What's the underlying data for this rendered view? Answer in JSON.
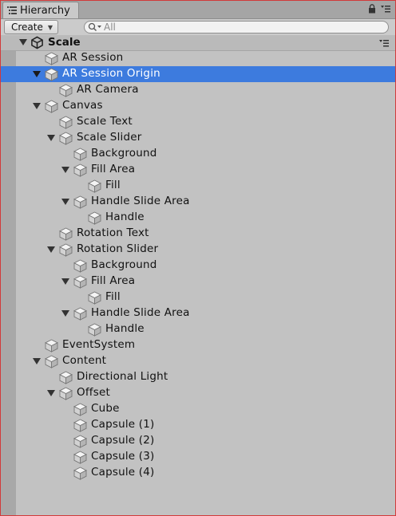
{
  "tab": {
    "label": "Hierarchy",
    "icon": "hierarchy-list-icon"
  },
  "toolbar": {
    "create_label": "Create",
    "search_placeholder": "All"
  },
  "scene": {
    "name": "Scale",
    "icon": "unity-scene-icon",
    "expanded": true
  },
  "tree": [
    {
      "label": "AR Session",
      "depth": 0,
      "expandable": false
    },
    {
      "label": "AR Session Origin",
      "depth": 0,
      "expandable": true,
      "expanded": true,
      "selected": true
    },
    {
      "label": "AR Camera",
      "depth": 1,
      "expandable": false
    },
    {
      "label": "Canvas",
      "depth": 0,
      "expandable": true,
      "expanded": true
    },
    {
      "label": "Scale Text",
      "depth": 1,
      "expandable": false
    },
    {
      "label": "Scale Slider",
      "depth": 1,
      "expandable": true,
      "expanded": true
    },
    {
      "label": "Background",
      "depth": 2,
      "expandable": false
    },
    {
      "label": "Fill Area",
      "depth": 2,
      "expandable": true,
      "expanded": true
    },
    {
      "label": "Fill",
      "depth": 3,
      "expandable": false
    },
    {
      "label": "Handle Slide Area",
      "depth": 2,
      "expandable": true,
      "expanded": true
    },
    {
      "label": "Handle",
      "depth": 3,
      "expandable": false
    },
    {
      "label": "Rotation Text",
      "depth": 1,
      "expandable": false
    },
    {
      "label": "Rotation Slider",
      "depth": 1,
      "expandable": true,
      "expanded": true
    },
    {
      "label": "Background",
      "depth": 2,
      "expandable": false
    },
    {
      "label": "Fill Area",
      "depth": 2,
      "expandable": true,
      "expanded": true
    },
    {
      "label": "Fill",
      "depth": 3,
      "expandable": false
    },
    {
      "label": "Handle Slide Area",
      "depth": 2,
      "expandable": true,
      "expanded": true
    },
    {
      "label": "Handle",
      "depth": 3,
      "expandable": false
    },
    {
      "label": "EventSystem",
      "depth": 0,
      "expandable": false
    },
    {
      "label": "Content",
      "depth": 0,
      "expandable": true,
      "expanded": true
    },
    {
      "label": "Directional Light",
      "depth": 1,
      "expandable": false
    },
    {
      "label": "Offset",
      "depth": 1,
      "expandable": true,
      "expanded": true
    },
    {
      "label": "Cube",
      "depth": 2,
      "expandable": false
    },
    {
      "label": "Capsule (1)",
      "depth": 2,
      "expandable": false
    },
    {
      "label": "Capsule (2)",
      "depth": 2,
      "expandable": false
    },
    {
      "label": "Capsule (3)",
      "depth": 2,
      "expandable": false
    },
    {
      "label": "Capsule (4)",
      "depth": 2,
      "expandable": false
    }
  ],
  "colors": {
    "selection": "#3d7bde",
    "panel_bg": "#c2c2c2",
    "gutter": "#a8a8a8",
    "border_accent": "#d23a3a"
  }
}
